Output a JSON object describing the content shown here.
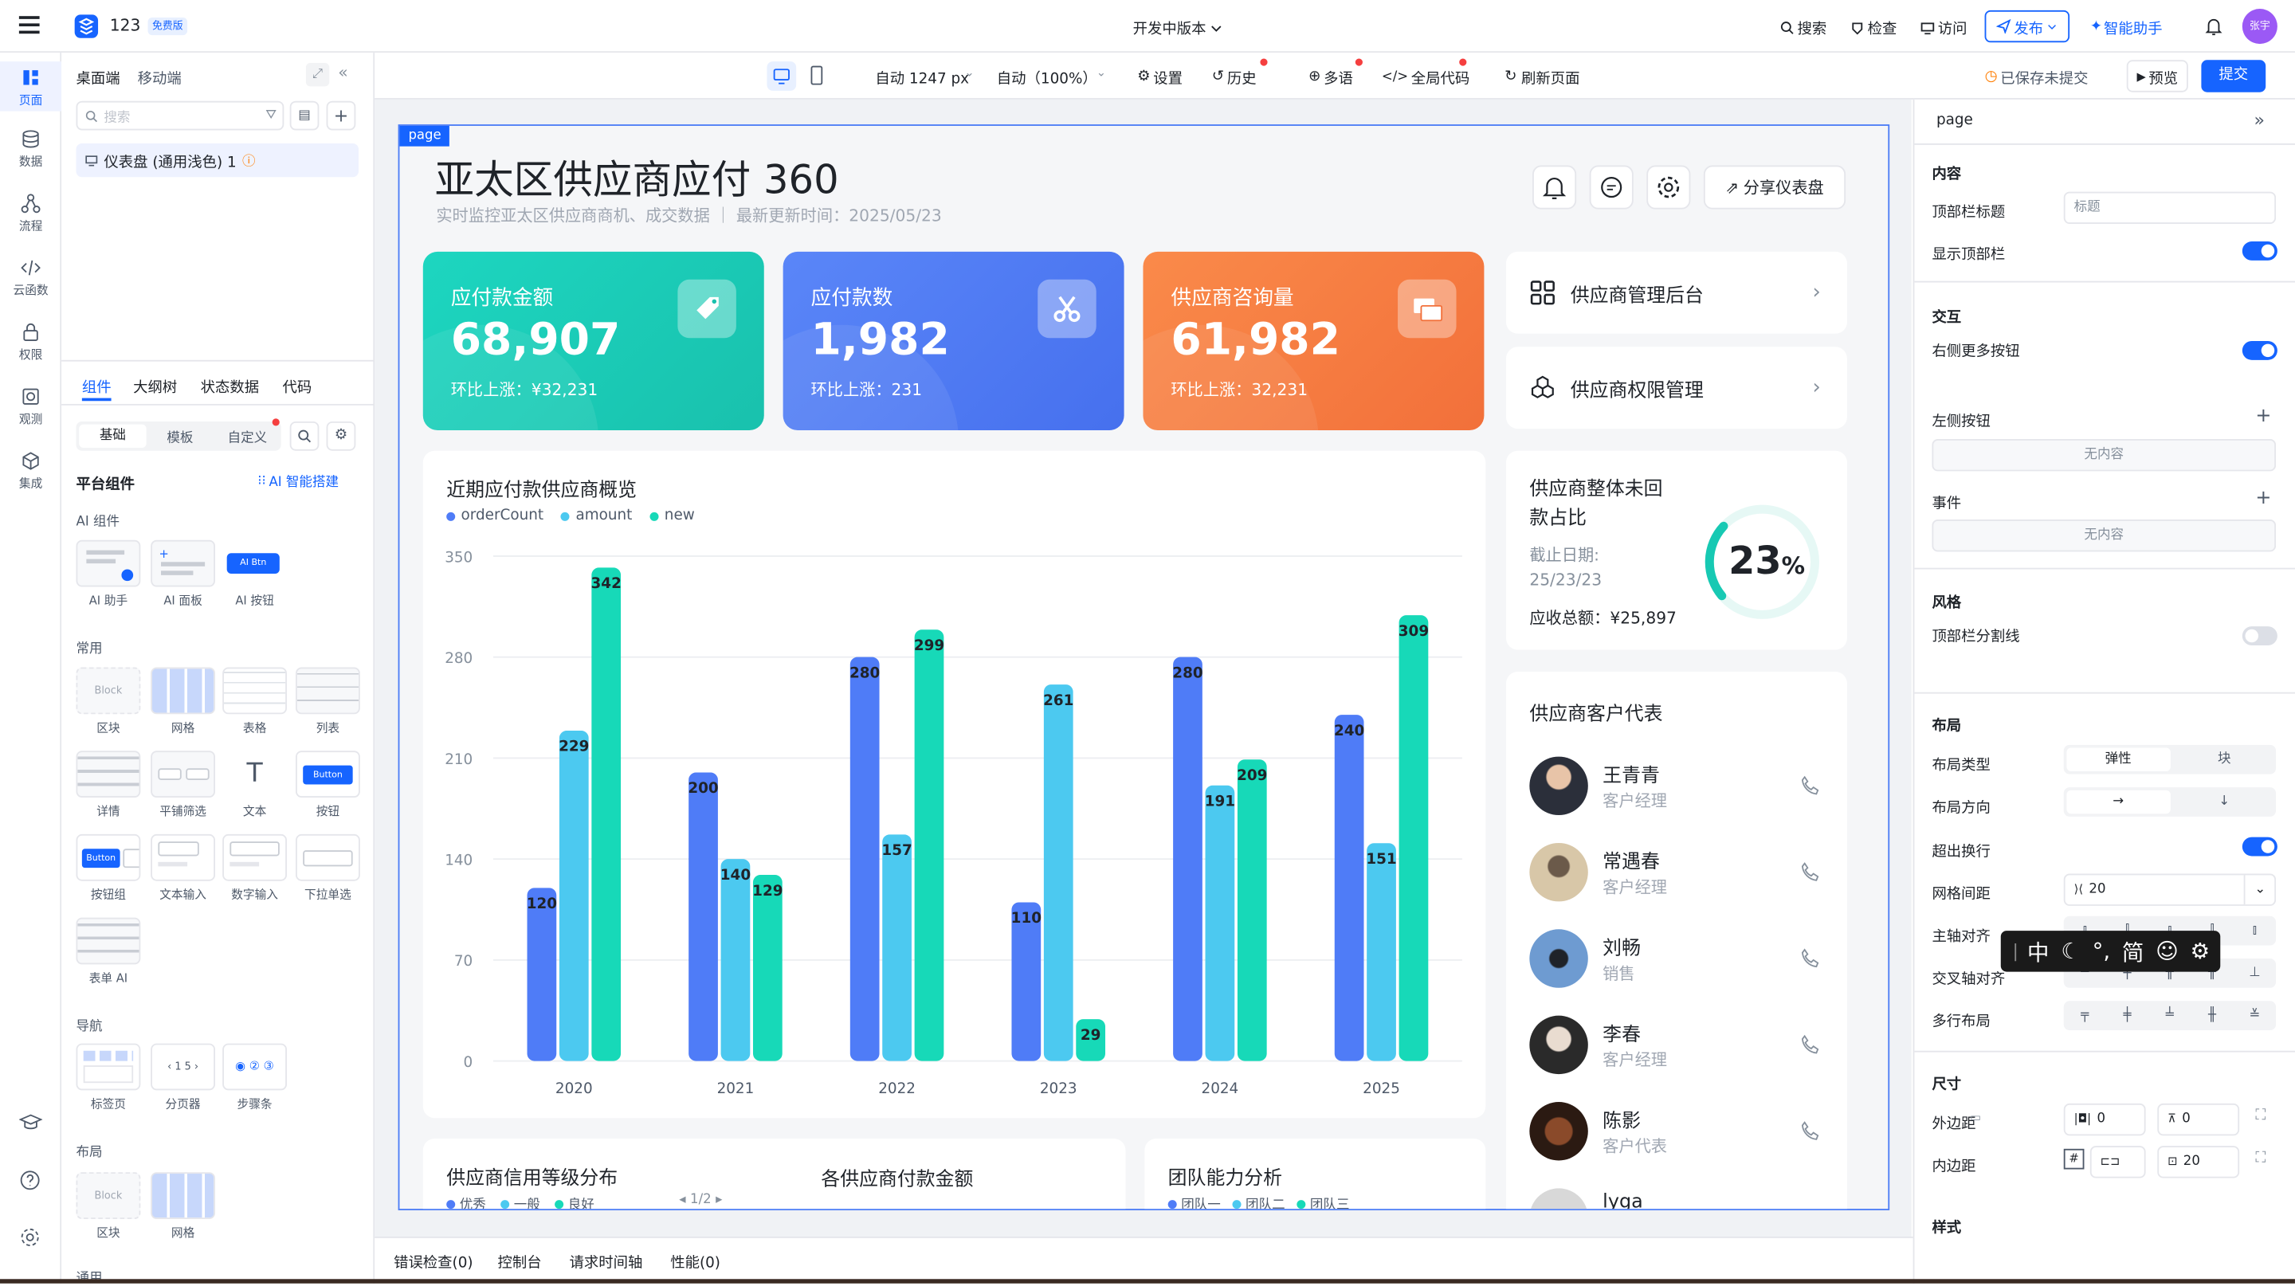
{
  "topbar": {
    "app_name": "123",
    "badge": "免费版",
    "version_label": "开发中版本",
    "search": "搜索",
    "inspect": "检查",
    "visit": "访问",
    "publish": "发布",
    "ai_assistant": "智能助手",
    "avatar_text": "张宇"
  },
  "rail": [
    {
      "label": "页面"
    },
    {
      "label": "数据"
    },
    {
      "label": "流程"
    },
    {
      "label": "云函数"
    },
    {
      "label": "权限"
    },
    {
      "label": "观测"
    },
    {
      "label": "集成"
    }
  ],
  "panel": {
    "tab_desktop": "桌面端",
    "tab_mobile": "移动端",
    "search_placeholder": "搜索",
    "page_item": "仪表盘 (通用浅色) 1",
    "bottom_tabs": [
      "组件",
      "大纲树",
      "状态数据",
      "代码"
    ],
    "sub_tabs": [
      "基础",
      "模板",
      "自定义"
    ],
    "platform_title": "平台组件",
    "ai_build": "AI 智能搭建",
    "ai_group": "AI 组件",
    "ai_items": [
      "AI 助手",
      "AI 面板",
      "AI 按钮"
    ],
    "ai_btn_text": "AI Btn",
    "common_group": "常用",
    "common_items": [
      "区块",
      "网格",
      "表格",
      "列表",
      "详情",
      "平铺筛选",
      "文本",
      "按钮",
      "按钮组",
      "文本输入",
      "数字输入",
      "下拉单选",
      "表单 AI"
    ],
    "block_text": "Block",
    "button_text": "Button",
    "nav_group": "导航",
    "nav_items": [
      "标签页",
      "分页器",
      "步骤条"
    ],
    "layout_group": "布局",
    "layout_items": [
      "区块",
      "网格"
    ],
    "more_group": "通用"
  },
  "toolbar": {
    "width": "自动 1247 px",
    "zoom": "自动（100%）",
    "settings": "设置",
    "history": "历史",
    "i18n": "多语",
    "global_code": "全局代码",
    "refresh": "刷新页面",
    "unsaved": "已保存未提交",
    "preview": "预览",
    "submit": "提交"
  },
  "page": {
    "tag": "page",
    "title": "亚太区供应商应付 360",
    "subtitle": "实时监控亚太区供应商商机、成交数据 ｜ 最新更新时间：2025/05/23",
    "share": "分享仪表盘",
    "kpis": [
      {
        "title": "应付款金额",
        "value": "68,907",
        "sub": "环比上涨：¥32,231",
        "color": "#17c9b3"
      },
      {
        "title": "应付款数",
        "value": "1,982",
        "sub": "环比上涨：231",
        "color": "#4f7cf7"
      },
      {
        "title": "供应商咨询量",
        "value": "61,982",
        "sub": "环比上涨：32,231",
        "color": "#f57c3a"
      }
    ],
    "links": [
      "供应商管理后台",
      "供应商权限管理"
    ],
    "ratio_card": {
      "title": "供应商整体未回款占比",
      "date_label": "截止日期:",
      "date_value": "25/23/23",
      "total": "应收总额：¥25,897",
      "percent_num": "23",
      "percent_sign": "%",
      "percent_value": 0.23
    },
    "contacts_title": "供应商客户代表",
    "contacts": [
      {
        "name": "王青青",
        "role": "客户经理"
      },
      {
        "name": "常遇春",
        "role": "客户经理"
      },
      {
        "name": "刘畅",
        "role": "销售"
      },
      {
        "name": "李春",
        "role": "客户经理"
      },
      {
        "name": "陈影",
        "role": "客户代表"
      },
      {
        "name": "lyga",
        "role": ""
      }
    ],
    "bottom_cards": {
      "credit_title": "供应商信用等级分布",
      "credit_legend": [
        "优秀",
        "一般",
        "良好"
      ],
      "pager": "1/2",
      "amount_title": "各供应商付款金额",
      "team_title": "团队能力分析",
      "team_legend": [
        "团队一",
        "团队二",
        "团队三"
      ]
    }
  },
  "chart_data": {
    "type": "bar",
    "title": "近期应付款供应商概览",
    "categories": [
      "2020",
      "2021",
      "2022",
      "2023",
      "2024",
      "2025"
    ],
    "series": [
      {
        "name": "orderCount",
        "values": [
          120,
          200,
          280,
          110,
          280,
          240
        ],
        "color": "#4f7cf7"
      },
      {
        "name": "amount",
        "values": [
          229,
          140,
          157,
          261,
          191,
          151
        ],
        "color": "#4cc9f0"
      },
      {
        "name": "new",
        "values": [
          342,
          129,
          299,
          29,
          209,
          309
        ],
        "color": "#17d9b8"
      }
    ],
    "ylim": [
      0,
      350
    ],
    "yticks": [
      "350",
      "280",
      "210",
      "140",
      "70",
      "0"
    ],
    "grid": true,
    "legend": "top-left"
  },
  "right": {
    "header": "page",
    "section_content": "内容",
    "topbar_title": "顶部栏标题",
    "topbar_title_placeholder": "标题",
    "show_topbar": "显示顶部栏",
    "section_interact": "交互",
    "right_more": "右侧更多按钮",
    "left_btn": "左侧按钮",
    "empty": "无内容",
    "events": "事件",
    "section_style": "风格",
    "topbar_divider": "顶部栏分割线",
    "section_layout": "布局",
    "layout_type": "布局类型",
    "layout_type_opts": [
      "弹性",
      "块"
    ],
    "layout_dir": "布局方向",
    "wrap": "超出换行",
    "grid_gap": "网格间距",
    "grid_gap_val": "20",
    "main_align": "主轴对齐",
    "cross_align": "交叉轴对齐",
    "multi_line": "多行布局",
    "section_size": "尺寸",
    "margin": "外边距",
    "margin_h": "0",
    "margin_v": "0",
    "padding": "内边距",
    "padding_v": "20",
    "section_style2": "样式"
  },
  "ime": [
    "中",
    "简"
  ],
  "bottom": {
    "tabs": [
      "错误检查(0)",
      "控制台",
      "请求时间轴",
      "性能(0)"
    ]
  }
}
